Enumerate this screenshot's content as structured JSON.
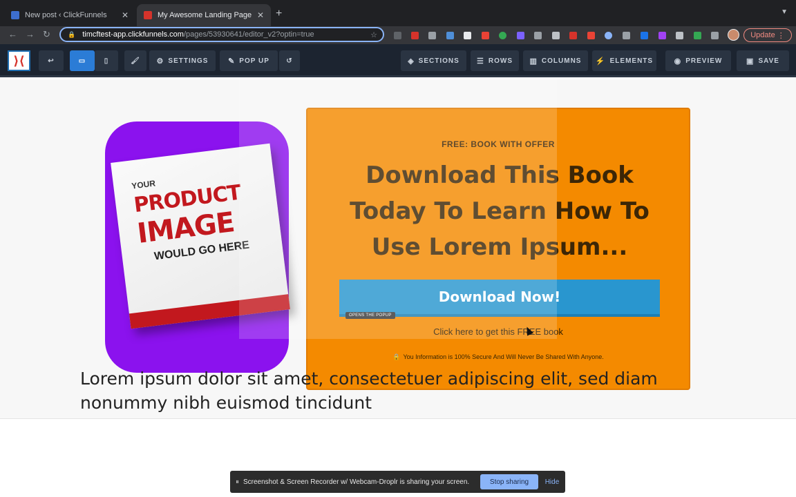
{
  "browser": {
    "tabs": [
      {
        "title": "New post ‹ ClickFunnels",
        "active": false
      },
      {
        "title": "My Awesome Landing Page",
        "active": true
      }
    ],
    "url_host": "timcftest-app.clickfunnels.com",
    "url_path": "/pages/53930641/editor_v2?optin=true",
    "update_label": "Update"
  },
  "editor": {
    "buttons": {
      "settings": "SETTINGS",
      "popup": "POP UP",
      "sections": "SECTIONS",
      "rows": "ROWS",
      "columns": "COLUMNS",
      "elements": "ELEMENTS",
      "preview": "PREVIEW",
      "save": "SAVE"
    },
    "logo_glyph": "⟩⟨"
  },
  "page": {
    "product": {
      "line1": "YOUR",
      "line2": "PRODUCT",
      "line3": "IMAGE",
      "line4": "WOULD GO HERE"
    },
    "offer": {
      "eyebrow": "FREE: BOOK WITH OFFER",
      "headline": "Download This Book Today To Learn How To Use Lorem Ipsum...",
      "button": "Download Now!",
      "popup_tag": "OPENS THE POPUP",
      "subline": "Click here to get this FREE book",
      "secure": "You Information is 100% Secure And Will Never Be Shared With Anyone."
    },
    "lorem": "Lorem ipsum dolor sit amet, consectetuer adipiscing elit, sed diam nonummy nibh euismod tincidunt"
  },
  "sharebar": {
    "message": "Screenshot & Screen Recorder w/ Webcam-Droplr is sharing your screen.",
    "stop": "Stop sharing",
    "hide": "Hide"
  },
  "colors": {
    "orange": "#f48a00",
    "purple": "#8b12ee",
    "blue_button": "#2996cf",
    "editor_bg": "#1c2430"
  }
}
